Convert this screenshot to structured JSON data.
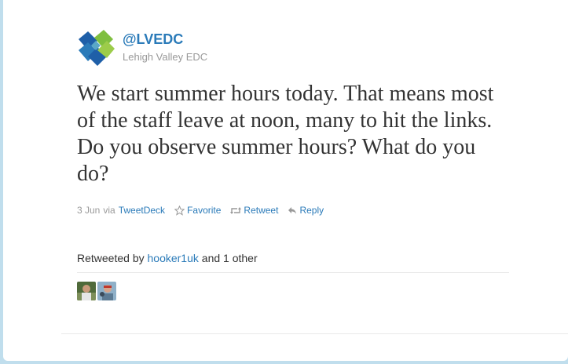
{
  "user": {
    "screen_name": "@LVEDC",
    "full_name": "Lehigh Valley EDC",
    "avatar_icon": "lvedc-logo-icon"
  },
  "tweet": {
    "text": "We start summer hours today. That means most of the staff leave at noon, many to hit the links. Do you observe summer hours? What do you do?",
    "date": "3 Jun",
    "via_label": "via",
    "source": "TweetDeck"
  },
  "actions": {
    "favorite": "Favorite",
    "retweet": "Retweet",
    "reply": "Reply"
  },
  "retweets": {
    "prefix": "Retweeted by",
    "user": "hooker1uk",
    "suffix": "and 1 other"
  },
  "colors": {
    "link": "#2b7bb9",
    "background": "#c0deed",
    "logo_blue": "#1f5fa8",
    "logo_green": "#7fbf3f"
  }
}
